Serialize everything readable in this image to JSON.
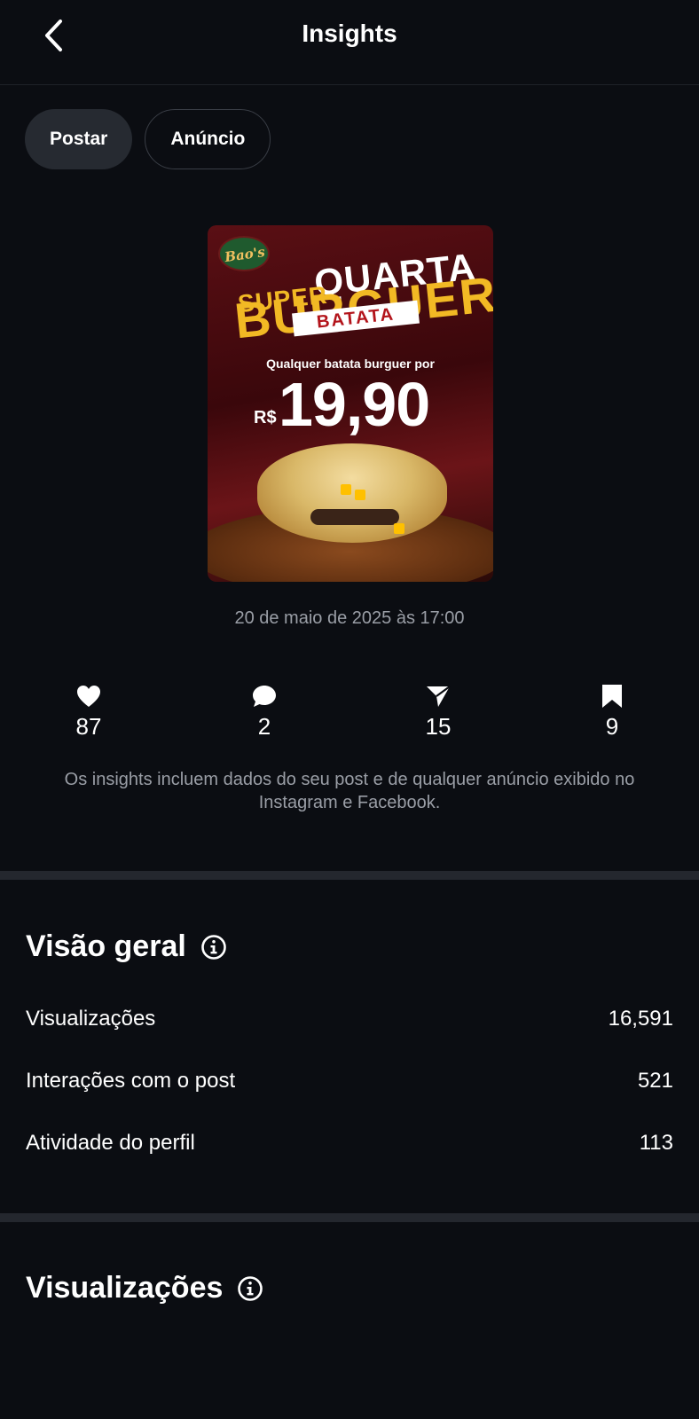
{
  "header": {
    "title": "Insights",
    "back_icon": "chevron-left-icon"
  },
  "tabs": [
    {
      "label": "Postar",
      "active": true
    },
    {
      "label": "Anúncio",
      "active": false
    }
  ],
  "post": {
    "image": {
      "brand": "Bao's",
      "headline_1": "SUPER",
      "headline_2": "QUARTA",
      "headline_3": "BURGUER",
      "headline_4": "BATATA",
      "offer_text": "Qualquer batata burguer por",
      "currency": "R$",
      "price": "19,90"
    },
    "date": "20 de maio de 2025 às 17:00"
  },
  "metrics": [
    {
      "icon": "heart-icon",
      "value": "87"
    },
    {
      "icon": "comment-icon",
      "value": "2"
    },
    {
      "icon": "share-icon",
      "value": "15"
    },
    {
      "icon": "bookmark-icon",
      "value": "9"
    }
  ],
  "note": "Os insights incluem dados do seu post e de qualquer anúncio exibido no Instagram e Facebook.",
  "overview": {
    "title": "Visão geral",
    "rows": [
      {
        "label": "Visualizações",
        "value": "16,591"
      },
      {
        "label": "Interações com o post",
        "value": "521"
      },
      {
        "label": "Atividade do perfil",
        "value": "113"
      }
    ]
  },
  "views_section": {
    "title": "Visualizações"
  },
  "colors": {
    "background": "#0b0d12",
    "text": "#f5f5f7",
    "muted": "#9a9ea6",
    "divider": "#24272e"
  }
}
